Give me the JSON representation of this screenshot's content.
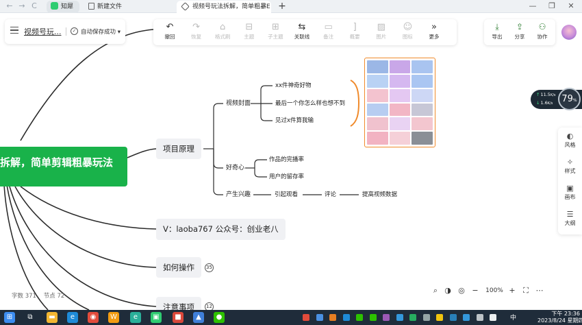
{
  "browser": {
    "tabs": [
      {
        "label": "知犀",
        "icon_color": "#2ecc71",
        "active": false
      },
      {
        "label": "新建文件",
        "icon": "document-icon",
        "active": false
      },
      {
        "label": "视频号玩法拆解，简单粗暴E",
        "icon": "mindmap-icon",
        "active": true
      }
    ],
    "new_tab": "+",
    "nav": {
      "back": "←",
      "forward": "→",
      "reload": "C"
    },
    "window": {
      "minimize": "—",
      "restore": "❐",
      "close": "✕"
    }
  },
  "doc": {
    "title": "视频号玩...",
    "save_status": "自动保存成功 ▾"
  },
  "toolbar": {
    "items": [
      {
        "label": "撤回",
        "icon": "undo-icon",
        "glyph": "↶",
        "enabled": true
      },
      {
        "label": "恢复",
        "icon": "redo-icon",
        "glyph": "↷",
        "enabled": false
      },
      {
        "label": "格式刷",
        "icon": "format-brush-icon",
        "glyph": "⌂",
        "enabled": false
      },
      {
        "label": "主题",
        "icon": "topic-icon",
        "glyph": "⊟",
        "enabled": false
      },
      {
        "label": "子主题",
        "icon": "subtopic-icon",
        "glyph": "⊞",
        "enabled": false
      },
      {
        "label": "关联线",
        "icon": "relation-line-icon",
        "glyph": "⇆",
        "enabled": true
      },
      {
        "label": "备注",
        "icon": "note-icon",
        "glyph": "▭",
        "enabled": false
      },
      {
        "label": "概要",
        "icon": "summary-icon",
        "glyph": "]",
        "enabled": false
      },
      {
        "label": "图片",
        "icon": "image-icon",
        "glyph": "▨",
        "enabled": false
      },
      {
        "label": "图标",
        "icon": "emoji-icon",
        "glyph": "☺",
        "enabled": false
      },
      {
        "label": "更多",
        "icon": "more-icon",
        "glyph": "»",
        "enabled": true
      }
    ]
  },
  "right_tools": [
    {
      "label": "导出",
      "icon": "export-icon",
      "glyph": "⤓"
    },
    {
      "label": "分享",
      "icon": "share-icon",
      "glyph": "⇪"
    },
    {
      "label": "协作",
      "icon": "collaborate-icon",
      "glyph": "⚇"
    }
  ],
  "mindmap": {
    "central": "拆解，简单剪辑粗暴玩法",
    "branches": [
      {
        "label": "项目原理"
      },
      {
        "label": "V：laoba767  公众号：创业老八"
      },
      {
        "label": "如何操作",
        "badge": "35"
      },
      {
        "label": "注意事项",
        "badge": "12"
      }
    ],
    "subtopics": {
      "cover": "视频封面",
      "curiosity": "好奇心",
      "interest": "产生兴趣"
    },
    "leaves": {
      "cover_items": [
        "xx件神奇好物",
        "最后一个你怎么样也想不到",
        "见过x件算我输"
      ],
      "curiosity_items": [
        "作品的完播率",
        "用户的留存率"
      ],
      "interest_chain": [
        "引起观看",
        "评论",
        "提高视频数据"
      ]
    },
    "thumbnail_colors": [
      "#9bb7e6",
      "#c9a7e8",
      "#a9c4f0",
      "#b9d2f4",
      "#d5b8f0",
      "#aac6f2",
      "#f3c3cf",
      "#e4c8f2",
      "#cdd7f5",
      "#b7cdf1",
      "#f2b6c5",
      "#c7c7d6",
      "#f0c2ce",
      "#e9d3f3",
      "#f3c6cf",
      "#f2b3c2",
      "#f5d0d8",
      "#8a8f96"
    ]
  },
  "speed": {
    "up": "11.5",
    "up_unit": "K/s",
    "down": "1.6",
    "down_unit": "K/s",
    "percent": "79",
    "percent_unit": "%"
  },
  "side_panel": [
    {
      "label": "风格",
      "icon": "palette-icon",
      "glyph": "◐"
    },
    {
      "label": "样式",
      "icon": "style-icon",
      "glyph": "✧"
    },
    {
      "label": "画布",
      "icon": "canvas-icon",
      "glyph": "▣"
    },
    {
      "label": "大纲",
      "icon": "outline-icon",
      "glyph": "☰"
    }
  ],
  "stats": {
    "word_label": "字数",
    "word_count": "371",
    "node_label": "节点",
    "node_count": "72"
  },
  "zoom": {
    "minus": "−",
    "value": "100%",
    "plus": "+"
  },
  "taskbar": {
    "clock_time": "下午 23:36",
    "clock_date": "2023/8/24 星期四",
    "ime": "中",
    "apps": [
      {
        "name": "windows-start-icon",
        "color": "#3b8cf0",
        "glyph": "⊞"
      },
      {
        "name": "task-view-icon",
        "color": "transparent",
        "glyph": "⧉"
      },
      {
        "name": "file-explorer-icon",
        "color": "#f2b632",
        "glyph": "▬"
      },
      {
        "name": "edge-icon",
        "color": "#1e8bd8",
        "glyph": "e"
      },
      {
        "name": "chrome-icon",
        "color": "#e34c3c",
        "glyph": "◉"
      },
      {
        "name": "xmind-icon",
        "color": "#f39c12",
        "glyph": "W"
      },
      {
        "name": "edge-beta-icon",
        "color": "#2ab09a",
        "glyph": "e"
      },
      {
        "name": "zhixi-icon",
        "color": "#2ecc71",
        "glyph": "▣"
      },
      {
        "name": "office-icon",
        "color": "#d9483b",
        "glyph": "■"
      },
      {
        "name": "photos-icon",
        "color": "#3f7fd8",
        "glyph": "▲"
      },
      {
        "name": "wechat-icon",
        "color": "#2dc100",
        "glyph": "●"
      }
    ],
    "tray": [
      "#e24b3b",
      "#4a90e2",
      "#e67e22",
      "#1e8bd8",
      "#2dc100",
      "#2dc100",
      "#9b59b6",
      "#3498db",
      "#27ae60",
      "#95a5a6",
      "#f1c40f",
      "#2980b9",
      "#3498db",
      "#bdc3c7",
      "#ecf0f1"
    ]
  }
}
